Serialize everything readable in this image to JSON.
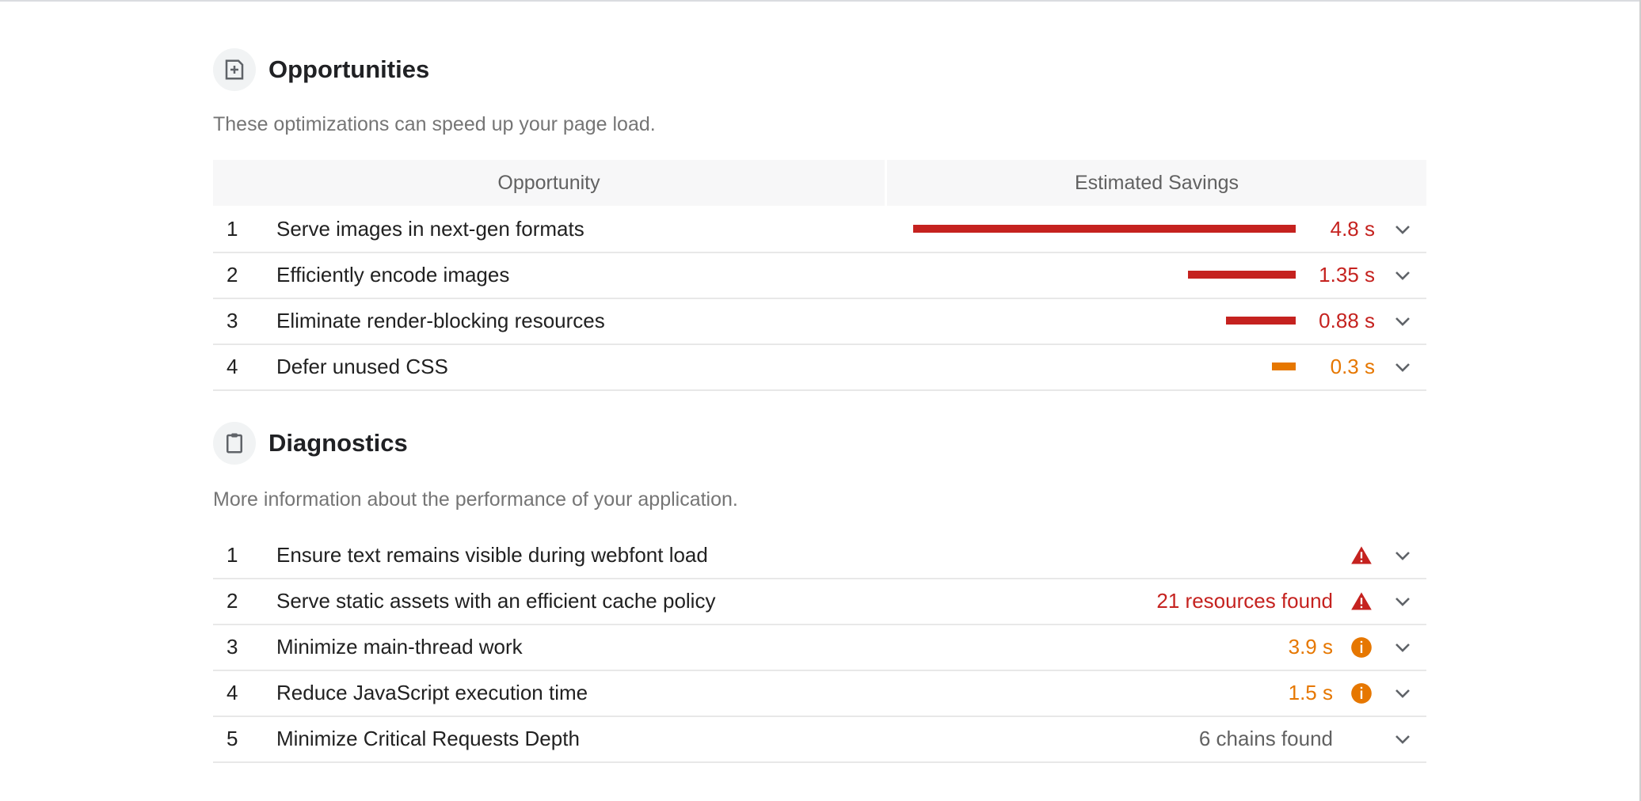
{
  "opportunities": {
    "title": "Opportunities",
    "description": "These optimizations can speed up your page load.",
    "col_opportunity": "Opportunity",
    "col_savings": "Estimated Savings",
    "items": [
      {
        "num": "1",
        "title": "Serve images in next-gen formats",
        "savings": "4.8 s",
        "fraction": 1.0,
        "severity": "fail",
        "color": "#c5221f"
      },
      {
        "num": "2",
        "title": "Efficiently encode images",
        "savings": "1.35 s",
        "fraction": 0.281,
        "severity": "fail",
        "color": "#c5221f"
      },
      {
        "num": "3",
        "title": "Eliminate render-blocking resources",
        "savings": "0.88 s",
        "fraction": 0.183,
        "severity": "fail",
        "color": "#c5221f"
      },
      {
        "num": "4",
        "title": "Defer unused CSS",
        "savings": "0.3 s",
        "fraction": 0.063,
        "severity": "average",
        "color": "#e67700"
      }
    ]
  },
  "diagnostics": {
    "title": "Diagnostics",
    "description": "More information about the performance of your application.",
    "items": [
      {
        "num": "1",
        "title": "Ensure text remains visible during webfont load",
        "value": "",
        "icon": "warning-triangle-icon",
        "severity": "fail"
      },
      {
        "num": "2",
        "title": "Serve static assets with an efficient cache policy",
        "value": "21 resources found",
        "icon": "warning-triangle-icon",
        "severity": "fail"
      },
      {
        "num": "3",
        "title": "Minimize main-thread work",
        "value": "3.9 s",
        "icon": "info-circle-icon",
        "severity": "average"
      },
      {
        "num": "4",
        "title": "Reduce JavaScript execution time",
        "value": "1.5 s",
        "icon": "info-circle-icon",
        "severity": "average"
      },
      {
        "num": "5",
        "title": "Minimize Critical Requests Depth",
        "value": "6 chains found",
        "icon": "",
        "severity": "informative"
      }
    ]
  },
  "colors": {
    "fail": "#c5221f",
    "average": "#e67700",
    "informative": "#616161"
  }
}
